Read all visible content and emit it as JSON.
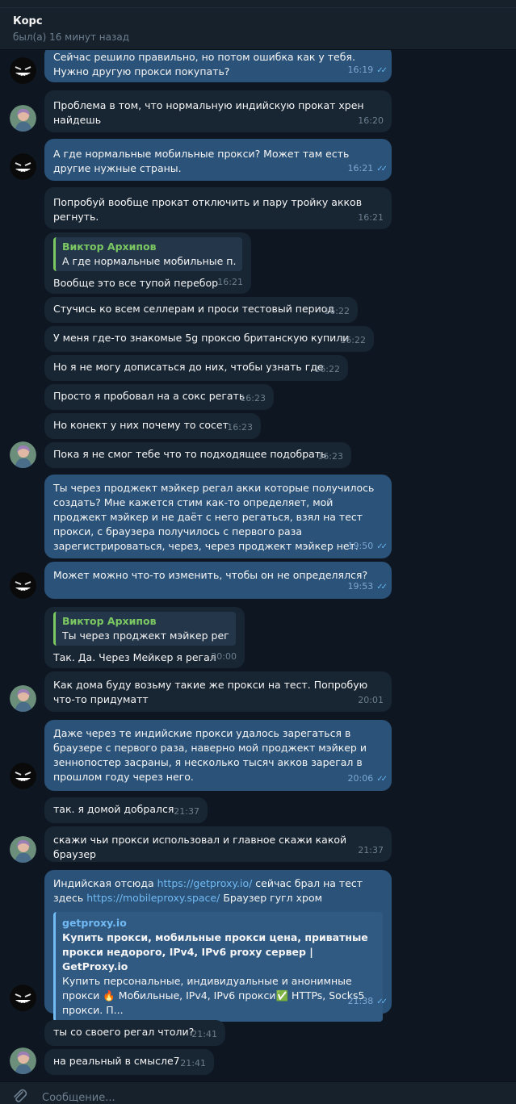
{
  "header": {
    "title": "Корс",
    "status": "был(а) 16 минут назад"
  },
  "messages": [
    {
      "text": "Сейчас решило правильно, но потом ошибка как у тебя. Нужно другую прокси покупать?",
      "time": "16:19"
    },
    {
      "text": "Проблема в том, что нормальную индийскую прокат хрен найдешь",
      "time": "16:20"
    },
    {
      "text": "А где нормальные мобильные прокси? Может там есть другие нужные страны.",
      "time": "16:21"
    },
    {
      "text": "Попробуй вообще прокат отключить и пару тройку акков регнуть.",
      "time": "16:21"
    },
    {
      "reply_name": "Виктор Архипов",
      "reply_text": "А где нормальные мобильные п...",
      "text": "Вообще это все тупой перебор",
      "time": "16:21"
    },
    {
      "text": "Стучись ко всем селлерам и проси тестовый период",
      "time": "16:22"
    },
    {
      "text": "У меня где-то знакомые 5g проксю британскую купили",
      "time": "16:22"
    },
    {
      "text": "Но я не могу дописаться до них, чтобы узнать где",
      "time": "16:22"
    },
    {
      "text": "Просто я пробовал на а сокс регать",
      "time": "16:23"
    },
    {
      "text": "Но конект у них почему то сосет",
      "time": "16:23"
    },
    {
      "text": "Пока я не смог тебе что то подходящее подобрать",
      "time": "16:23"
    },
    {
      "text": "Ты через проджект мэйкер регал акки которые получилось создать? Мне кажется стим как-то определяет, мой проджект мэйкер и не даёт с него регаться, взял на тест прокси, с браузера получилось с первого раза зарегистрироваться, через, через проджект мэйкер нет.",
      "time": "19:50"
    },
    {
      "text": "Может можно что-то изменить, чтобы он не определялся?",
      "time": "19:53"
    },
    {
      "reply_name": "Виктор Архипов",
      "reply_text": "Ты через проджект мэйкер регал...",
      "text": "Так. Да. Через Мейкер я регал",
      "time": "20:00"
    },
    {
      "text": "Как дома буду возьму такие же прокси на тест. Попробую что-то придуматт",
      "time": "20:01"
    },
    {
      "text": "Даже через те индийские прокси удалось зарегаться в браузере с первого раза, наверно мой проджект мэйкер и зеннопостер засраны, я несколько тысяч акков зарегал в прошлом году через него.",
      "time": "20:06"
    },
    {
      "text": "так. я домой добрался",
      "time": "21:37"
    },
    {
      "text": "скажи чьи прокси использовал и главное скажи какой браузер",
      "time": "21:37"
    },
    {
      "text_a": "Индийская отсюда ",
      "link_a": "https://getproxy.io/",
      "text_b": " сейчас брал на тест здесь ",
      "link_b": "https://mobileproxy.space/",
      "text_c": " Браузер гугл хром",
      "preview_site": "getproxy.io",
      "preview_title": "Купить прокси, мобильные прокси цена, приватные прокси недорого, IPv4, IPv6 proxy сервер  | GetProxy.io",
      "preview_desc": "Купить персональные, индивидуальные и анонимные прокси 🔥 Мобильные, IPv4, IPv6 прокси✅ HTTPs, Socks5 прокси. П...",
      "time": "21:38"
    },
    {
      "text": "ты со своего регал чтоли?",
      "time": "21:41"
    },
    {
      "text": "на реальный в смысле7",
      "time": "21:41"
    }
  ],
  "ticks": "✓✓",
  "composer": {
    "placeholder": "Сообщение..."
  },
  "colors": {
    "background": "#0e1621",
    "incoming": "#182533",
    "outgoing": "#2b5278",
    "accent": "#71baf4",
    "reply_name": "#7bc862"
  },
  "icons": {
    "avatar_self": "grin-face-avatar",
    "avatar_peer": "user-photo-avatar",
    "read": "double-check-icon",
    "attach": "paperclip-icon"
  }
}
